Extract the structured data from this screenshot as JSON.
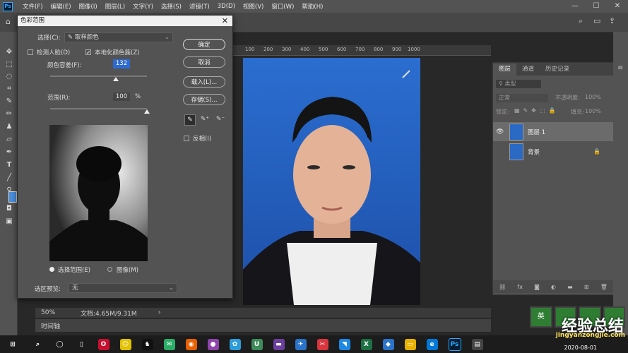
{
  "menu": {
    "logo": "Ps",
    "items": [
      "文件(F)",
      "编辑(E)",
      "图像(I)",
      "图层(L)",
      "文字(Y)",
      "选择(S)",
      "滤镜(T)",
      "3D(D)",
      "视图(V)",
      "窗口(W)",
      "帮助(H)"
    ]
  },
  "window_controls": {
    "minimize": "—",
    "maximize": "☐",
    "close": "✕"
  },
  "dialog": {
    "title": "色彩范围",
    "select_label": "选择(C):",
    "select_value": "取样颜色",
    "detect_faces": "检测人脸(D)",
    "localized_clusters": "本地化颜色簇(Z)",
    "fuzziness_label": "颜色容差(F):",
    "fuzziness_value": "132",
    "range_label": "范围(R):",
    "range_value": "100",
    "range_unit": "%",
    "fuzziness_level": 0.68,
    "range_level": 1.0,
    "buttons": {
      "ok": "确定",
      "cancel": "取消",
      "load": "载入(L)...",
      "save": "存储(S)..."
    },
    "invert": "反相(I)",
    "radio_selection": "选择范围(E)",
    "radio_image": "图像(M)",
    "preview_label": "选区预览:",
    "preview_value": "无"
  },
  "ruler": {
    "ticks": [
      "100",
      "200",
      "300",
      "400",
      "500",
      "600",
      "700",
      "800",
      "900",
      "1000"
    ]
  },
  "status": {
    "zoom": "50%",
    "doc": "文档:4.65M/9.31M",
    "arrow": "›"
  },
  "timeline": "时间轴",
  "panels": {
    "tabs": [
      "图层",
      "通道",
      "历史记录"
    ],
    "search_placeholder": "类型",
    "blend_mode": "正常",
    "opacity_label": "不透明度:",
    "opacity_value": "100%",
    "lock_label": "锁定:",
    "fill_label": "填充:",
    "fill_value": "100%",
    "layers": [
      {
        "name": "图层 1",
        "visible": true,
        "selected": true
      },
      {
        "name": "背景",
        "visible": false,
        "selected": false,
        "locked": true
      }
    ]
  },
  "taskbar": {
    "datetime": "2020-08-01"
  },
  "watermark": {
    "text": "经验总结",
    "url": "jingyanzongjie.com"
  },
  "colors": {
    "accent": "#31a8ff",
    "photo_bg": "#2c6fcc",
    "panel": "#535353"
  }
}
